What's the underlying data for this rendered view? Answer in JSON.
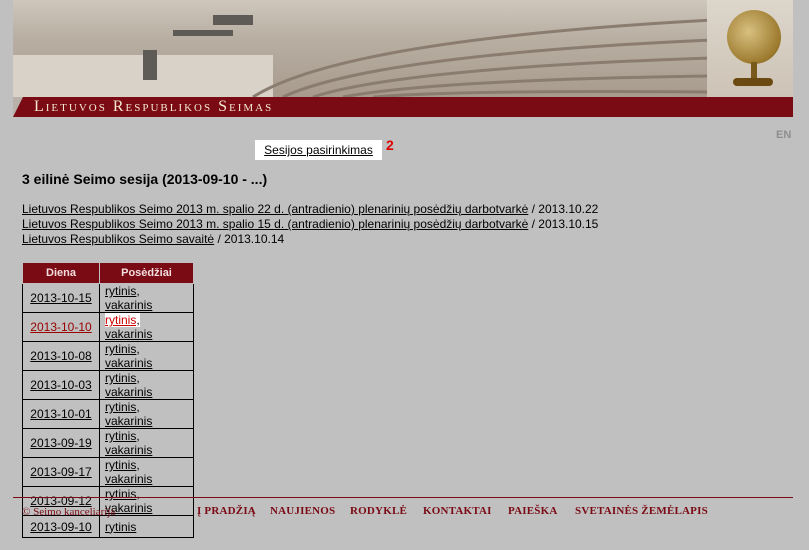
{
  "header": {
    "title": "Lietuvos Respublikos Seimas",
    "language_link": "EN"
  },
  "session_selector": {
    "label": "Sesijos pasirinkimas",
    "badge": "2"
  },
  "session_title": "3 eilinė Seimo sesija (2013-09-10 - ...)",
  "links": [
    {
      "text": "Lietuvos Respublikos Seimo 2013 m. spalio 22 d. (antradienio) plenarinių posėdžių darbotvarkė",
      "date": " / 2013.10.22"
    },
    {
      "text": "Lietuvos Respublikos Seimo 2013 m. spalio 15 d. (antradienio) plenarinių posėdžių darbotvarkė",
      "date": " / 2013.10.15"
    },
    {
      "text": "Lietuvos Respublikos Seimo savaitė",
      "date": " / 2013.10.14"
    }
  ],
  "table": {
    "headers": [
      "Diena",
      "Posėdžiai"
    ],
    "rows": [
      {
        "date": "2013-10-15",
        "morning": "rytinis",
        "evening": "vakarinis"
      },
      {
        "date": "2013-10-10",
        "morning": "rytinis",
        "evening": "vakarinis"
      },
      {
        "date": "2013-10-08",
        "morning": "rytinis",
        "evening": "vakarinis"
      },
      {
        "date": "2013-10-03",
        "morning": "rytinis",
        "evening": "vakarinis"
      },
      {
        "date": "2013-10-01",
        "morning": "rytinis",
        "evening": "vakarinis"
      },
      {
        "date": "2013-09-19",
        "morning": "rytinis",
        "evening": "vakarinis"
      },
      {
        "date": "2013-09-17",
        "morning": "rytinis",
        "evening": "vakarinis"
      },
      {
        "date": "2013-09-12",
        "morning": "rytinis",
        "evening": "vakarinis"
      },
      {
        "date": "2013-09-10",
        "morning": "rytinis",
        "evening": ""
      }
    ],
    "separator": ", "
  },
  "footer": {
    "copyright": "© Seimo kanceliarija",
    "nav": [
      "Į PRADŽIĄ",
      "NAUJIENOS",
      "RODYKLĖ",
      "KONTAKTAI",
      "PAIEŠKA",
      "SVETAINĖS ŽEMĖLAPIS"
    ]
  },
  "colors": {
    "brand": "#7a0a14",
    "background": "#c0c0c0",
    "hover_link": "#cc0000"
  }
}
